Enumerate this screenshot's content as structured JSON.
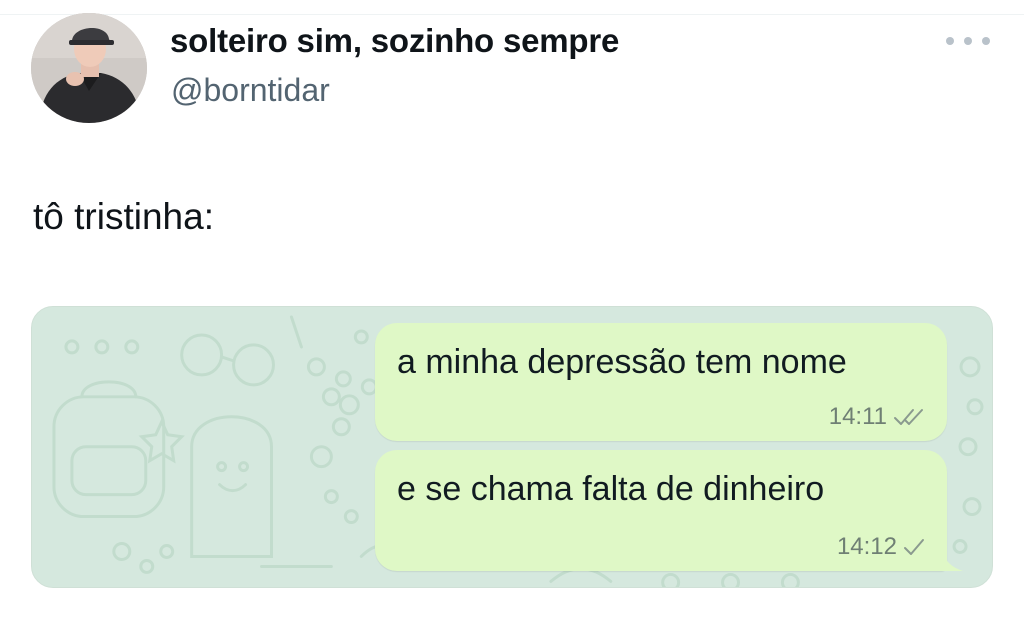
{
  "tweet": {
    "author": {
      "display_name": "solteiro sim, sozinho sempre",
      "handle": "@borntidar"
    },
    "text": "tô tristinha:"
  },
  "chat": {
    "messages": [
      {
        "text": "a minha depressão tem nome",
        "time": "14:11",
        "status_icon": "double-check-icon"
      },
      {
        "text": "e se chama falta de dinheiro",
        "time": "14:12",
        "status_icon": "single-check-icon"
      }
    ]
  },
  "colors": {
    "chat_background": "#d5e8de",
    "bubble": "#dff8c6",
    "handle_gray": "#536471"
  }
}
